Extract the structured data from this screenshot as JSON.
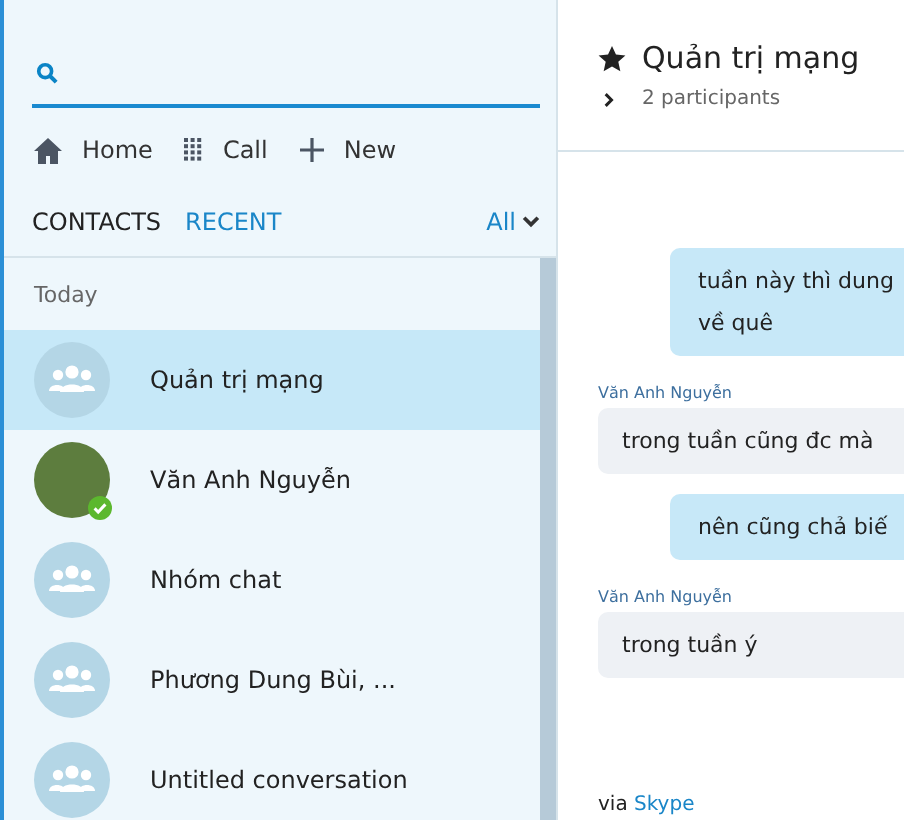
{
  "nav": [
    {
      "kind": "home",
      "label": "Home"
    },
    {
      "kind": "call",
      "label": "Call"
    },
    {
      "kind": "new",
      "label": "New"
    }
  ],
  "tabs": [
    {
      "label": "CONTACTS",
      "selected": false
    },
    {
      "label": "RECENT",
      "selected": true
    }
  ],
  "filter": {
    "label": "All"
  },
  "section": "Today",
  "conversations": [
    {
      "kind": "group",
      "name": "Quản trị mạng",
      "selected": true,
      "online": false
    },
    {
      "kind": "person",
      "name": "Văn Anh Nguyễn",
      "selected": false,
      "online": true
    },
    {
      "kind": "group",
      "name": "Nhóm chat",
      "selected": false,
      "online": false
    },
    {
      "kind": "group",
      "name": "Phương Dung Bùi, ...",
      "selected": false,
      "online": false
    },
    {
      "kind": "group",
      "name": "Untitled conversation",
      "selected": false,
      "online": false
    }
  ],
  "chat": {
    "title": "Quản trị mạng",
    "favorite": true,
    "participants": "2 participants",
    "messages": [
      {
        "kind": "outgoing",
        "text": "tuần này thì dung\nvề quê"
      },
      {
        "kind": "incoming",
        "sender": "Văn Anh Nguyễn",
        "text": "trong tuần cũng đc mà"
      },
      {
        "kind": "outgoing",
        "text": "nên cũng chả biế"
      },
      {
        "kind": "incoming",
        "sender": "Văn Anh Nguyễn",
        "text": "trong tuần ý"
      }
    ],
    "footer_prefix": "via",
    "footer_link": "Skype"
  }
}
